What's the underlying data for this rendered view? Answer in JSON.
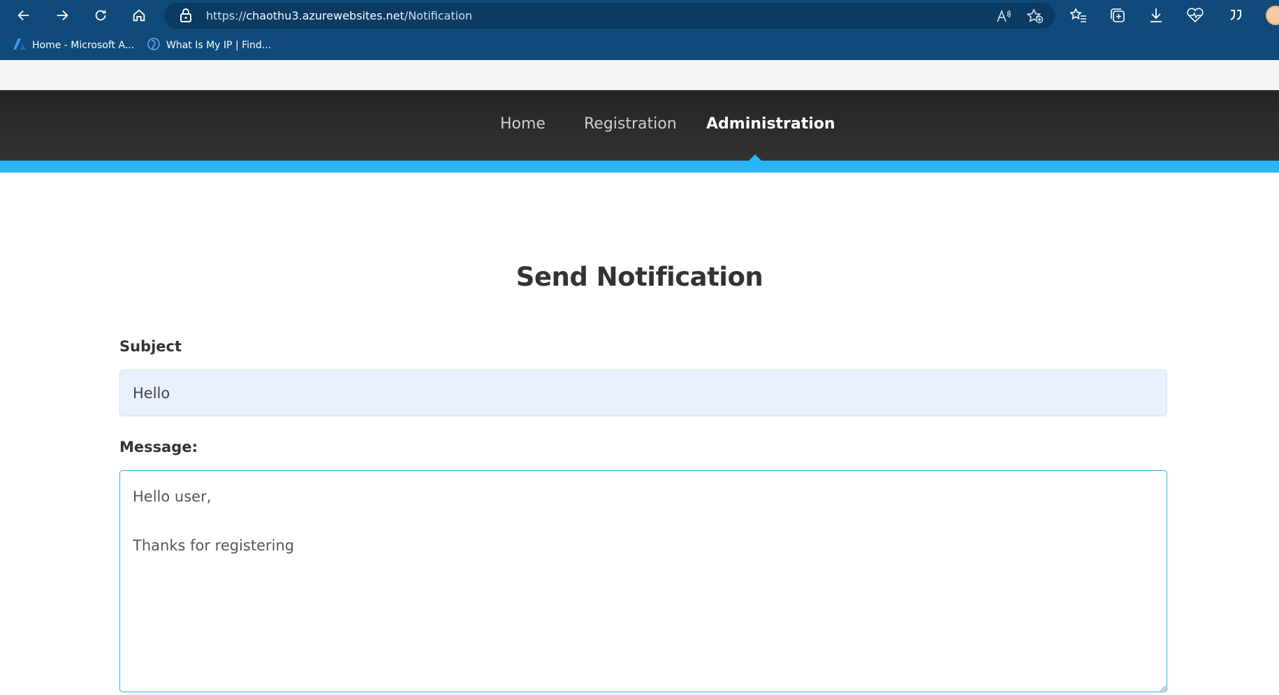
{
  "browser": {
    "url_scheme": "https://",
    "url_host": "chaothu3.azurewebsites.net",
    "url_path": "/Notification",
    "favorites": [
      {
        "label": "Home - Microsoft A...",
        "icon": "azure-icon"
      },
      {
        "label": "What Is My IP | Find...",
        "icon": "whatismyip-icon"
      }
    ]
  },
  "nav": {
    "items": [
      {
        "label": "Home",
        "active": false
      },
      {
        "label": "Registration",
        "active": false
      },
      {
        "label": "Administration",
        "active": true
      }
    ]
  },
  "page": {
    "title": "Send Notification"
  },
  "form": {
    "subject_label": "Subject",
    "subject_value": "Hello",
    "message_label": "Message:",
    "message_value": "Hello user,\n\nThanks for registering"
  },
  "colors": {
    "browser_chrome": "#0f4a7a",
    "nav_background": "#2a2a2a",
    "accent": "#29b6f6",
    "input_fill": "#e8f0fe"
  }
}
